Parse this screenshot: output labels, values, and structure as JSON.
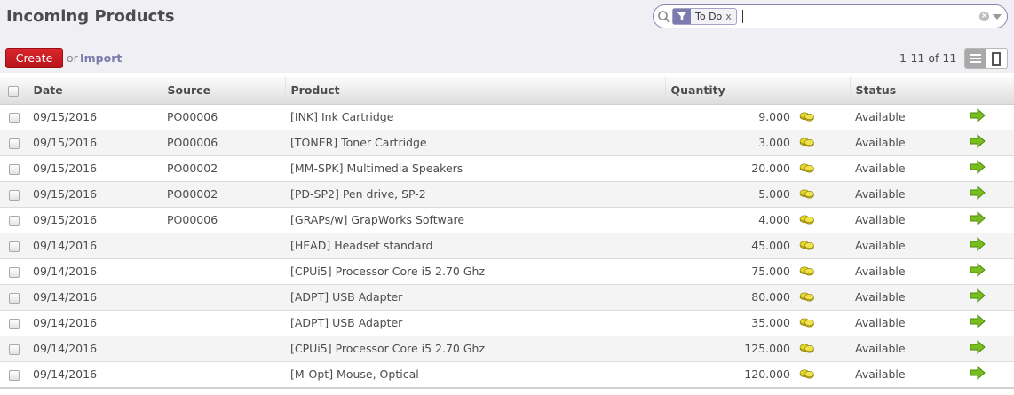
{
  "header": {
    "title": "Incoming Products"
  },
  "search": {
    "facet_label": "To Do",
    "facet_remove": "x",
    "query": ""
  },
  "toolbar": {
    "create_label": "Create",
    "or_text": "or",
    "import_label": "Import"
  },
  "pager": {
    "text": "1-11 of 11"
  },
  "table": {
    "columns": [
      "Date",
      "Source",
      "Product",
      "Quantity",
      "Status"
    ],
    "rows": [
      {
        "date": "09/15/2016",
        "source": "PO00006",
        "product": "[INK] Ink Cartridge",
        "quantity": "9.000",
        "status": "Available"
      },
      {
        "date": "09/15/2016",
        "source": "PO00006",
        "product": "[TONER] Toner Cartridge",
        "quantity": "3.000",
        "status": "Available"
      },
      {
        "date": "09/15/2016",
        "source": "PO00002",
        "product": "[MM-SPK] Multimedia Speakers",
        "quantity": "20.000",
        "status": "Available"
      },
      {
        "date": "09/15/2016",
        "source": "PO00002",
        "product": "[PD-SP2] Pen drive, SP-2",
        "quantity": "5.000",
        "status": "Available"
      },
      {
        "date": "09/15/2016",
        "source": "PO00006",
        "product": "[GRAPs/w] GrapWorks Software",
        "quantity": "4.000",
        "status": "Available"
      },
      {
        "date": "09/14/2016",
        "source": "",
        "product": "[HEAD] Headset standard",
        "quantity": "45.000",
        "status": "Available"
      },
      {
        "date": "09/14/2016",
        "source": "",
        "product": "[CPUi5] Processor Core i5 2.70 Ghz",
        "quantity": "75.000",
        "status": "Available"
      },
      {
        "date": "09/14/2016",
        "source": "",
        "product": "[ADPT] USB Adapter",
        "quantity": "80.000",
        "status": "Available"
      },
      {
        "date": "09/14/2016",
        "source": "",
        "product": "[ADPT] USB Adapter",
        "quantity": "35.000",
        "status": "Available"
      },
      {
        "date": "09/14/2016",
        "source": "",
        "product": "[CPUi5] Processor Core i5 2.70 Ghz",
        "quantity": "125.000",
        "status": "Available"
      },
      {
        "date": "09/14/2016",
        "source": "",
        "product": "[M-Opt] Mouse, Optical",
        "quantity": "120.000",
        "status": "Available"
      }
    ]
  },
  "icons": {
    "row_quantity_icon": "coins-icon",
    "row_action_icon": "arrow-right-icon",
    "search_icon": "search-icon",
    "filter_icon": "filter-icon"
  },
  "colors": {
    "accent": "#7c7bad",
    "create_button": "#c61a20",
    "action_arrow": "#6fb219",
    "coins": "#d7c61a"
  }
}
